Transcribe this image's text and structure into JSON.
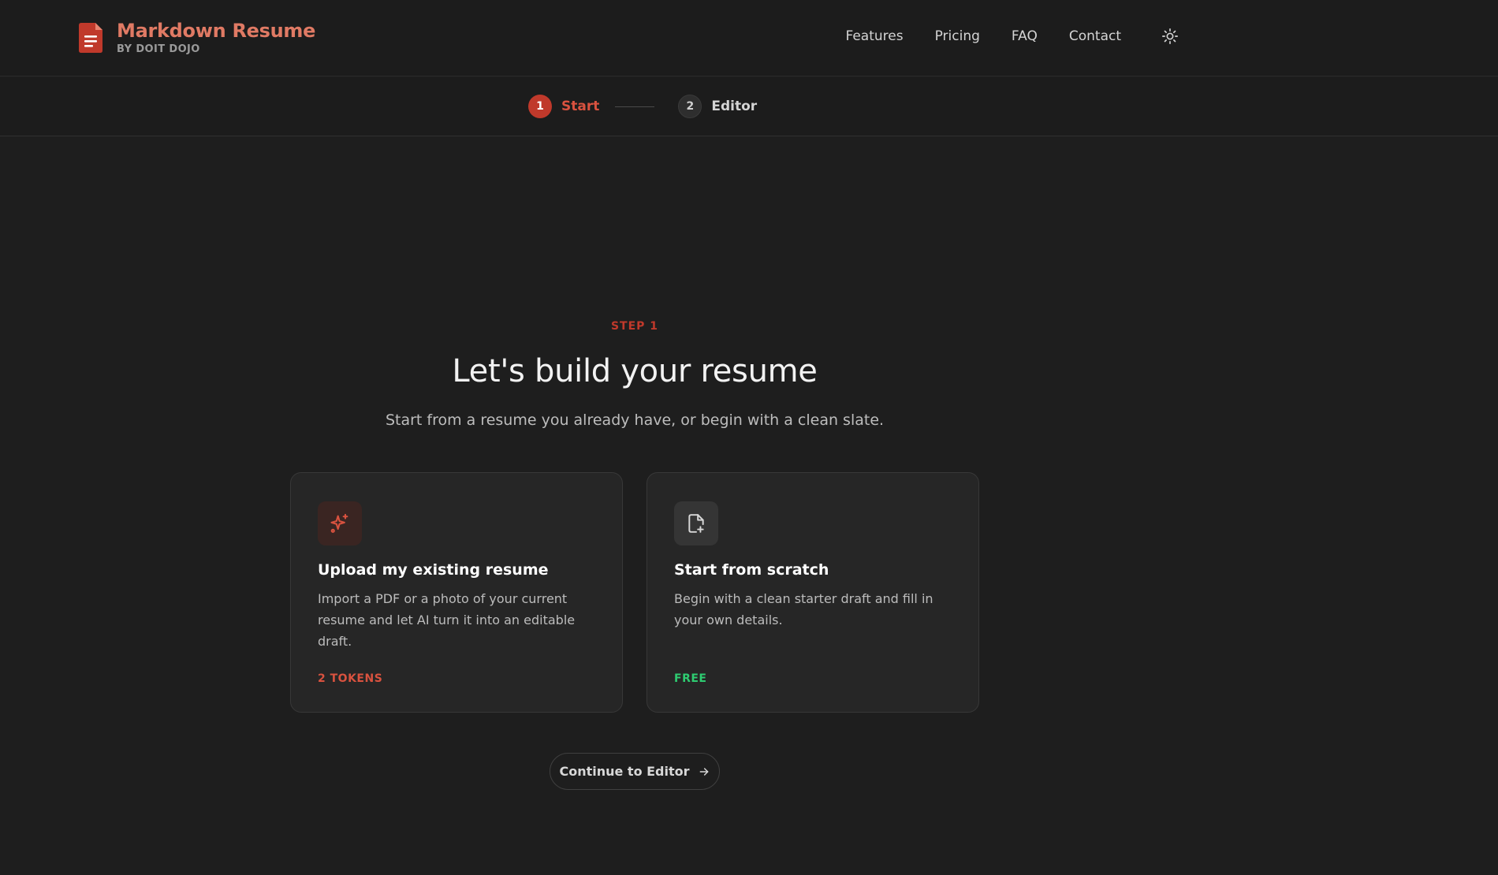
{
  "brand": {
    "title": "Markdown Resume",
    "subtitle": "BY DOIT DOJO",
    "icon": "document-icon",
    "color": "#c0392b"
  },
  "nav": {
    "items": [
      {
        "label": "Features"
      },
      {
        "label": "Pricing"
      },
      {
        "label": "FAQ"
      },
      {
        "label": "Contact"
      }
    ],
    "theme_toggle_icon": "sun-icon"
  },
  "stepper": {
    "steps": [
      {
        "number": "1",
        "label": "Start",
        "active": true
      },
      {
        "number": "2",
        "label": "Editor",
        "active": false
      }
    ]
  },
  "hero": {
    "eyebrow": "STEP 1",
    "title": "Let's build your resume",
    "subtitle": "Start from a resume you already have, or begin with a clean slate."
  },
  "options": [
    {
      "icon": "sparkles-icon",
      "title": "Upload my existing resume",
      "description": "Import a PDF or a photo of your current resume and let AI turn it into an editable draft.",
      "tag": "2 TOKENS",
      "tag_color": "#d9523f"
    },
    {
      "icon": "file-plus-icon",
      "title": "Start from scratch",
      "description": "Begin with a clean starter draft and fill in your own details.",
      "tag": "FREE",
      "tag_color": "#2ecc71"
    }
  ],
  "continue": {
    "label": "Continue to Editor",
    "icon": "arrow-right-icon"
  }
}
